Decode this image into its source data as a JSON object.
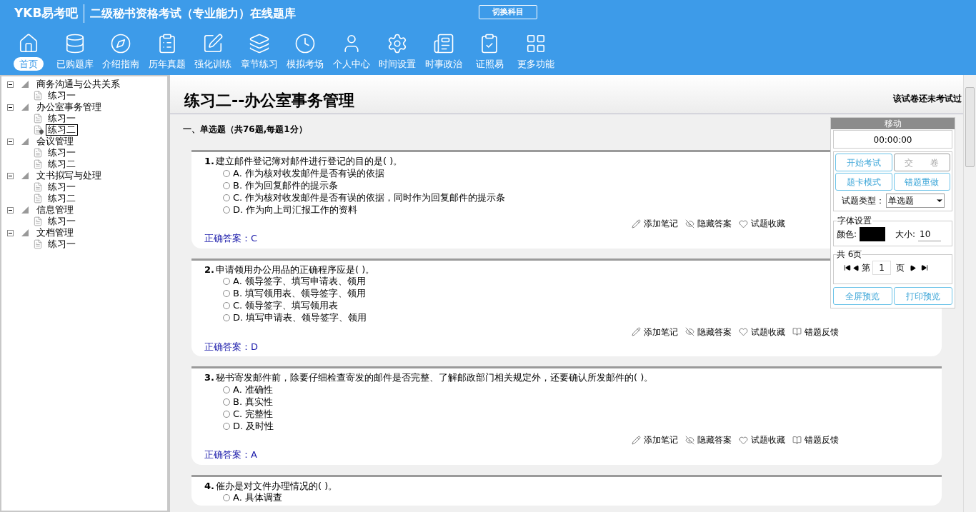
{
  "header": {
    "logo": "YKB易考吧",
    "title": "二级秘书资格考试（专业能力）在线题库",
    "switch_button": "切换科目"
  },
  "nav": [
    {
      "label": "首页",
      "selected": true
    },
    {
      "label": "已购题库",
      "selected": false
    },
    {
      "label": "介绍指南",
      "selected": false
    },
    {
      "label": "历年真题",
      "selected": false
    },
    {
      "label": "强化训练",
      "selected": false
    },
    {
      "label": "章节练习",
      "selected": false
    },
    {
      "label": "模拟考场",
      "selected": false
    },
    {
      "label": "个人中心",
      "selected": false
    },
    {
      "label": "时间设置",
      "selected": false
    },
    {
      "label": "时事政治",
      "selected": false
    },
    {
      "label": "证照易",
      "selected": false
    },
    {
      "label": "更多功能",
      "selected": false
    }
  ],
  "tree": [
    {
      "label": "商务沟通与公共关系",
      "expanded": true,
      "children": [
        {
          "label": "练习一",
          "selected": false
        }
      ]
    },
    {
      "label": "办公室事务管理",
      "expanded": true,
      "children": [
        {
          "label": "练习一",
          "selected": false
        },
        {
          "label": "练习二",
          "selected": true
        }
      ]
    },
    {
      "label": "会议管理",
      "expanded": true,
      "children": [
        {
          "label": "练习一",
          "selected": false
        },
        {
          "label": "练习二",
          "selected": false
        }
      ]
    },
    {
      "label": "文书拟写与处理",
      "expanded": true,
      "children": [
        {
          "label": "练习一",
          "selected": false
        },
        {
          "label": "练习二",
          "selected": false
        }
      ]
    },
    {
      "label": "信息管理",
      "expanded": true,
      "children": [
        {
          "label": "练习一",
          "selected": false
        }
      ]
    },
    {
      "label": "文档管理",
      "expanded": true,
      "children": [
        {
          "label": "练习一",
          "selected": false
        }
      ]
    }
  ],
  "paper": {
    "title": "练习二--办公室事务管理",
    "status": "该试卷还未考试过",
    "section": "一、单选题（共76题,每题1分）"
  },
  "questions": [
    {
      "number": "1.",
      "text": "建立邮件登记簿对邮件进行登记的目的是( )。",
      "options": [
        {
          "label": "A. 作为核对收发邮件是否有误的依据",
          "selected": false
        },
        {
          "label": "B. 作为回复邮件的提示条",
          "selected": false
        },
        {
          "label": "C. 作为核对收发邮件是否有误的依据，同时作为回复邮件的提示条",
          "selected": false
        },
        {
          "label": "D. 作为向上司汇报工作的资料",
          "selected": false
        }
      ],
      "actions": [
        {
          "kind": "note",
          "label": "添加笔记"
        },
        {
          "kind": "hide",
          "label": "隐藏答案"
        },
        {
          "kind": "favorite",
          "label": "试题收藏"
        }
      ],
      "answer": "正确答案：C"
    },
    {
      "number": "2.",
      "text": "申请领用办公用品的正确程序应是( )。",
      "options": [
        {
          "label": "A. 领导签字、填写申请表、领用",
          "selected": false
        },
        {
          "label": "B. 填写领用表、领导签字、领用",
          "selected": false
        },
        {
          "label": "C. 领导签字、填写领用表",
          "selected": false
        },
        {
          "label": "D. 填写申请表、领导签字、领用",
          "selected": false
        }
      ],
      "actions": [
        {
          "kind": "note",
          "label": "添加笔记"
        },
        {
          "kind": "hide",
          "label": "隐藏答案"
        },
        {
          "kind": "favorite",
          "label": "试题收藏"
        },
        {
          "kind": "report",
          "label": "错题反馈"
        }
      ],
      "answer": "正确答案：D"
    },
    {
      "number": "3.",
      "text": "秘书寄发邮件前，除要仔细检查寄发的邮件是否完整、了解邮政部门相关规定外，还要确认所发邮件的( )。",
      "options": [
        {
          "label": "A. 准确性",
          "selected": false
        },
        {
          "label": "B. 真实性",
          "selected": false
        },
        {
          "label": "C. 完整性",
          "selected": false
        },
        {
          "label": "D. 及时性",
          "selected": false
        }
      ],
      "actions": [
        {
          "kind": "note",
          "label": "添加笔记"
        },
        {
          "kind": "hide",
          "label": "隐藏答案"
        },
        {
          "kind": "favorite",
          "label": "试题收藏"
        },
        {
          "kind": "report",
          "label": "错题反馈"
        }
      ],
      "answer": "正确答案：A"
    },
    {
      "number": "4.",
      "text": "催办是对文件办理情况的( )。",
      "options": [
        {
          "label": "A. 具体调查",
          "selected": false
        }
      ]
    }
  ],
  "panel": {
    "move": "移动",
    "timer": "00:00:00",
    "buttons": [
      {
        "label": "开始考试",
        "disabled": false
      },
      {
        "label": "交　　卷",
        "disabled": true
      },
      {
        "label": "题卡模式",
        "disabled": false
      },
      {
        "label": "错题重做",
        "disabled": false
      }
    ],
    "type_label": "试题类型：",
    "type_value": "单选题",
    "font_group": "字体设置",
    "color_label": "颜色:",
    "size_label": "大小:",
    "size_value": "10",
    "pages_group": "共 6页",
    "page_prefix": "第",
    "page_value": "1",
    "page_suffix": "页",
    "bottom_buttons": [
      "全屏预览",
      "打印预览"
    ]
  }
}
